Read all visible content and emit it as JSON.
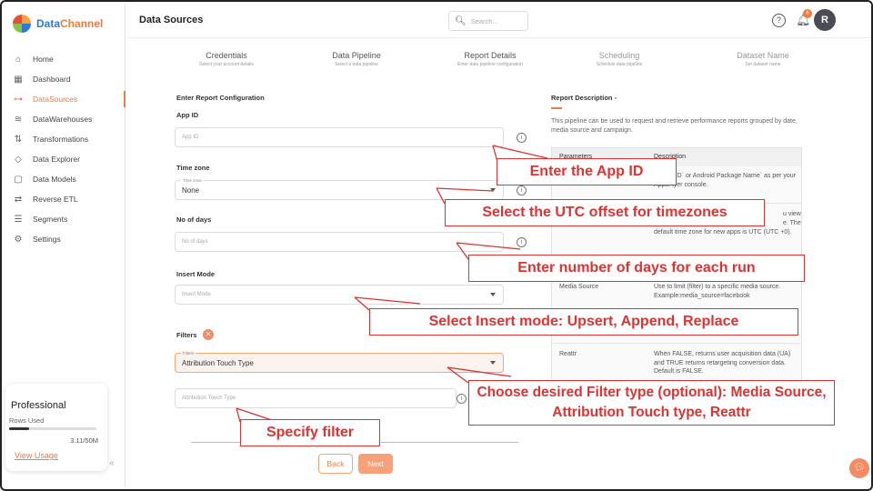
{
  "app": {
    "brand_a": "Data",
    "brand_b": "Channel"
  },
  "header": {
    "title": "Data Sources",
    "search_placeholder": "Search...",
    "help": "?",
    "bell_badge": "6",
    "avatar": "R"
  },
  "sidebar": {
    "items": [
      {
        "label": "Home",
        "icon": "home-icon"
      },
      {
        "label": "Dashboard",
        "icon": "dashboard-icon"
      },
      {
        "label": "DataSources",
        "icon": "datasources-icon",
        "active": true
      },
      {
        "label": "DataWarehouses",
        "icon": "database-icon"
      },
      {
        "label": "Transformations",
        "icon": "transform-icon"
      },
      {
        "label": "Data Explorer",
        "icon": "explorer-icon"
      },
      {
        "label": "Data Models",
        "icon": "models-icon"
      },
      {
        "label": "Reverse ETL",
        "icon": "reverse-etl-icon"
      },
      {
        "label": "Segments",
        "icon": "segments-icon"
      },
      {
        "label": "Settings",
        "icon": "settings-icon"
      }
    ],
    "plan": {
      "title": "Professional",
      "rows_label": "Rows Used",
      "count": "3.11/50M",
      "usage_fraction": 0.062,
      "link": "View Usage"
    },
    "collapse": "«"
  },
  "steps": [
    {
      "label": "Credentials",
      "sub": "Select your account details"
    },
    {
      "label": "Data Pipeline",
      "sub": "Select a data pipeline"
    },
    {
      "label": "Report Details",
      "sub": "Enter data pipeline configuration"
    },
    {
      "label": "Scheduling",
      "sub": "Schedule data pipeline"
    },
    {
      "label": "Dataset Name",
      "sub": "Set dataset name"
    }
  ],
  "form": {
    "section": "Enter Report Configuration",
    "app_id_label": "App ID",
    "app_id_placeholder": "App ID",
    "timezone_label": "Time zone",
    "timezone_float": "Time zone",
    "timezone_value": "None",
    "days_label": "No of days",
    "days_placeholder": "No of days",
    "insert_label": "Insert Mode",
    "insert_placeholder": "Insert Mode",
    "filters_label": "Filters",
    "filter_float": "Filters",
    "filter_value": "Attribution Touch Type",
    "filter_input_placeholder": "Attribution Touch Type",
    "info": "i",
    "back": "Back",
    "next": "Next"
  },
  "description": {
    "title": "Report Description -",
    "text": "This pipeline can be used to request and retrieve performance reports grouped by date, media source and campaign.",
    "headers": [
      "Parameters",
      "Description"
    ],
    "row1_desc": "Bundle ID` or Android Package Name` as per your AppsFlyer console.",
    "row2_desc": "default time zone for new apps is UTC (UTC +0).",
    "row2_frag_a": "u view",
    "row2_frag_b": "e. The",
    "row3_param": "Media Source",
    "row3_desc": "Use to limit (filter) to a specific media source. Example:media_source=facebook",
    "row4_param": "Reattr",
    "row4_desc": "When FALSE, returns user acquisition data (UA) and TRUE returns retargeting conversion data. Default is FALSE."
  },
  "callouts": {
    "app_id": "Enter the App ID",
    "timezone": "Select the UTC offset for timezones",
    "days": "Enter number of days for each run",
    "insert": "Select Insert mode: Upsert, Append, Replace",
    "filter_type": "Choose desired Filter type (optional): Media Source, Attribution Touch type, Reattr",
    "specify": "Specify filter"
  },
  "colors": {
    "accent": "#f07b3f",
    "callout": "#dd3333",
    "brand_blue": "#2d7ad6"
  }
}
